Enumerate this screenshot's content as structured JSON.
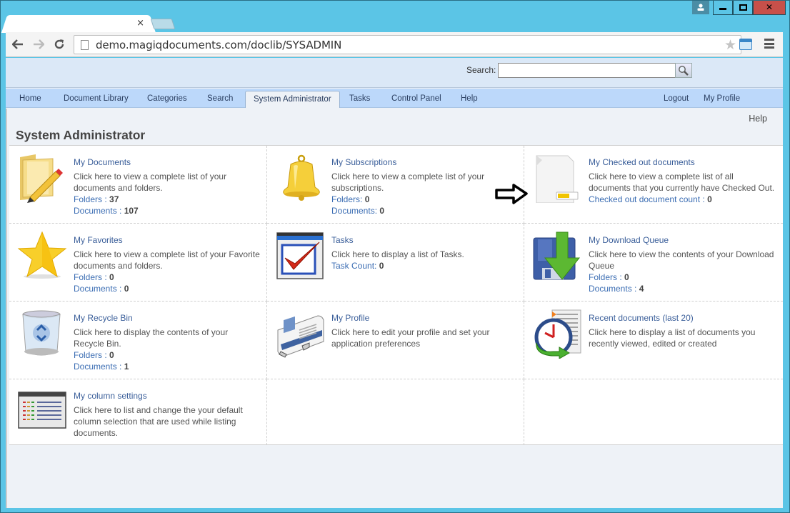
{
  "browser": {
    "tab_title": "",
    "tab_close": "×",
    "url": "demo.magiqdocuments.com/doclib/SYSADMIN",
    "window_controls": {
      "user": "user-icon",
      "minimize": "minimize-icon",
      "maximize": "maximize-icon",
      "close": "✕"
    }
  },
  "header": {
    "search_label": "Search:",
    "search_value": "",
    "search_button_icon": "magnifier-icon"
  },
  "nav": {
    "items": [
      {
        "label": "Home"
      },
      {
        "label": "Document Library"
      },
      {
        "label": "Categories"
      },
      {
        "label": "Search"
      },
      {
        "label": "System Administrator",
        "active": true
      },
      {
        "label": "Tasks"
      },
      {
        "label": "Control Panel"
      },
      {
        "label": "Help"
      }
    ],
    "right_items": [
      {
        "label": "Logout"
      },
      {
        "label": "My Profile"
      }
    ]
  },
  "page": {
    "help_link": "Help",
    "title": "System Administrator"
  },
  "tiles": [
    {
      "icon": "folder-pencil-icon",
      "title": "My Documents",
      "desc": "Click here to view a complete list of your documents and folders.",
      "stats": [
        {
          "label": "Folders : ",
          "value": "37"
        },
        {
          "label": "Documents : ",
          "value": "107"
        }
      ]
    },
    {
      "icon": "bell-icon",
      "title": "My Subscriptions",
      "desc": "Click here to view a complete list of your subscriptions.",
      "stats": [
        {
          "label": "Folders: ",
          "value": "0"
        },
        {
          "label": "Documents: ",
          "value": "0"
        }
      ]
    },
    {
      "icon": "checked-out-document-icon",
      "title": "My Checked out documents",
      "desc": "Click here to view a complete list of all documents that you currently have Checked Out.",
      "stats": [
        {
          "label": "Checked out document count : ",
          "value": "0"
        }
      ]
    },
    {
      "icon": "star-icon",
      "title": "My Favorites",
      "desc": "Click here to view a complete list of your Favorite documents and folders.",
      "stats": [
        {
          "label": "Folders : ",
          "value": "0"
        },
        {
          "label": "Documents : ",
          "value": "0"
        }
      ]
    },
    {
      "icon": "task-checkbox-icon",
      "title": "Tasks",
      "desc": "Click here to display a list of Tasks.",
      "stats": [
        {
          "label": "Task Count: ",
          "value": "0"
        }
      ]
    },
    {
      "icon": "download-floppy-icon",
      "title": "My Download Queue",
      "desc": "Click here to view the contents of your Download Queue",
      "stats": [
        {
          "label": "Folders : ",
          "value": "0"
        },
        {
          "label": "Documents : ",
          "value": "4"
        }
      ]
    },
    {
      "icon": "recycle-bin-icon",
      "title": "My Recycle Bin",
      "desc": "Click here to display the contents of your Recycle Bin.",
      "stats": [
        {
          "label": "Folders : ",
          "value": "0"
        },
        {
          "label": "Documents : ",
          "value": "1"
        }
      ]
    },
    {
      "icon": "profile-card-icon",
      "title": "My Profile",
      "desc": "Click here to edit your profile and set your application preferences",
      "stats": []
    },
    {
      "icon": "recent-clock-icon",
      "title": "Recent documents (last 20)",
      "desc": "Click here to display a list of documents you recently viewed, edited or created",
      "stats": []
    },
    {
      "icon": "column-settings-icon",
      "title": "My column settings",
      "desc": "Click here to list and change the your default column selection that are used while listing documents.",
      "stats": []
    },
    {
      "icon": "",
      "title": "",
      "desc": "",
      "stats": []
    },
    {
      "icon": "",
      "title": "",
      "desc": "",
      "stats": []
    }
  ],
  "annotation": {
    "icon": "arrow-right-icon"
  }
}
